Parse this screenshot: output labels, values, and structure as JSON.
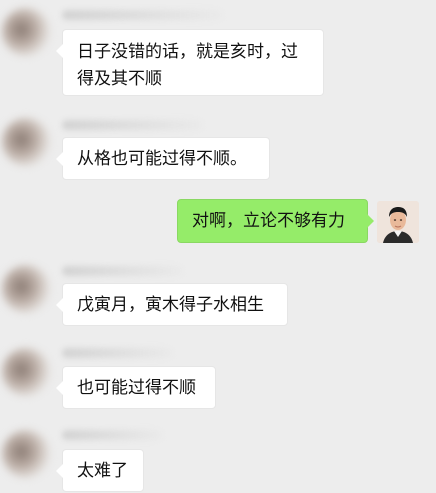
{
  "messages": [
    {
      "side": "left",
      "text_line1": "日子没错的话，就是亥时，过",
      "text_line2": "得及其不顺"
    },
    {
      "side": "left",
      "text": "从格也可能过得不顺。"
    },
    {
      "side": "right",
      "text": "对啊，立论不够有力"
    },
    {
      "side": "left",
      "text": "戊寅月，寅木得子水相生"
    },
    {
      "side": "left",
      "text": "也可能过得不顺"
    },
    {
      "side": "left",
      "text": "太难了"
    }
  ],
  "colors": {
    "background": "#ededed",
    "incoming_bubble": "#ffffff",
    "outgoing_bubble": "#95ec69"
  }
}
